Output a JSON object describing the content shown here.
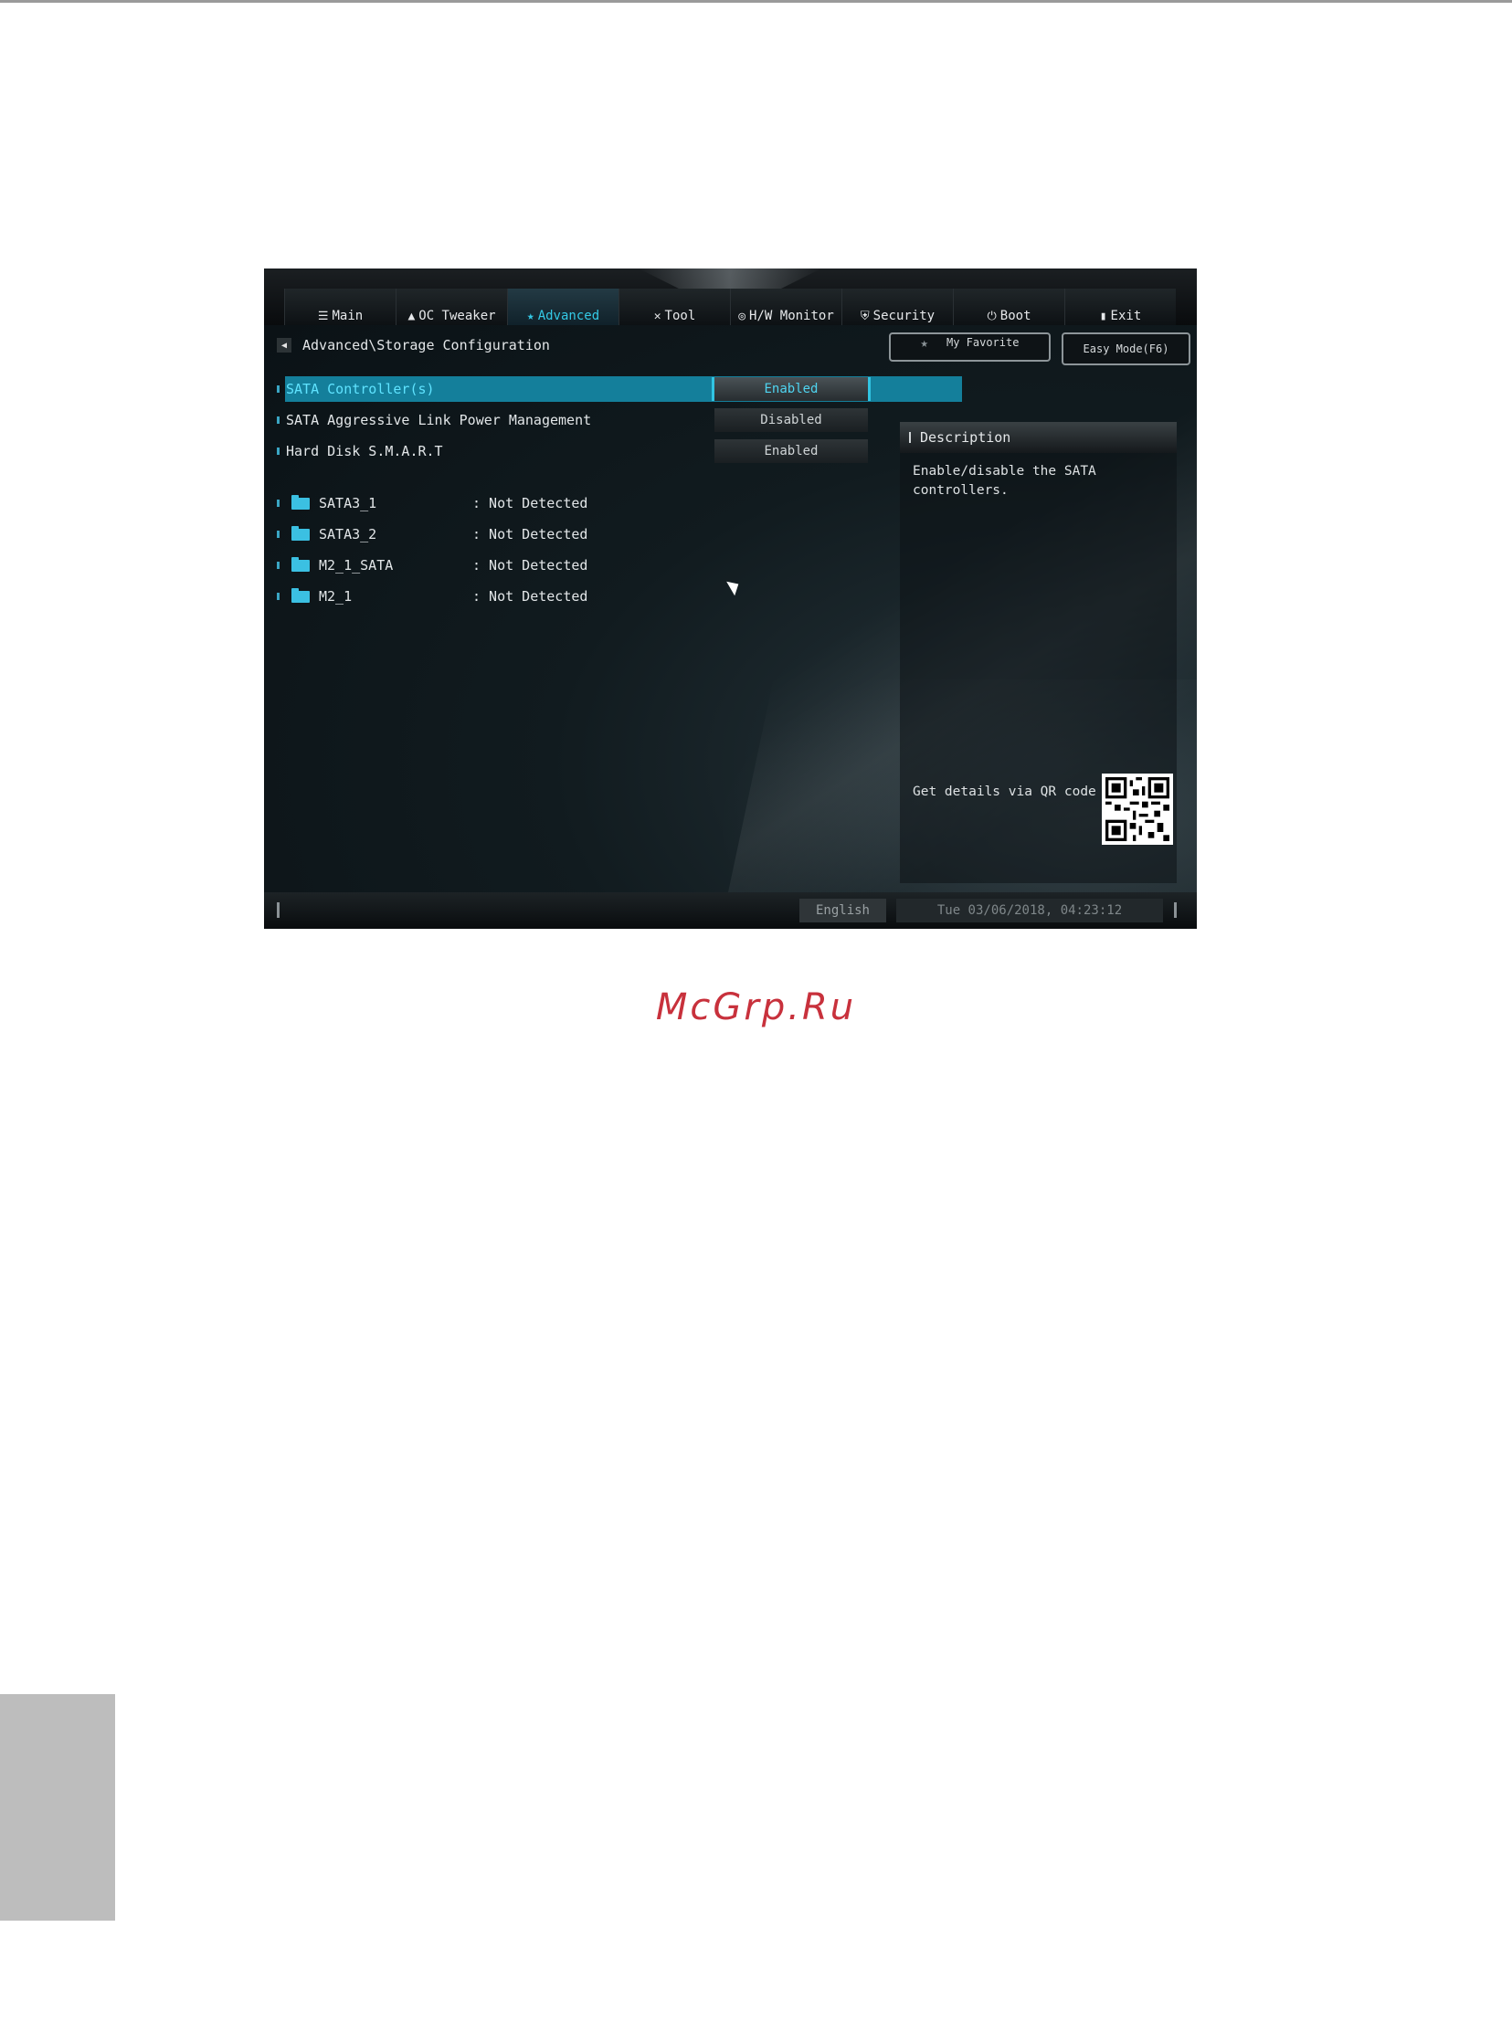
{
  "watermark": "McGrp.Ru",
  "tabs": [
    {
      "label": "Main",
      "icon": "list-icon"
    },
    {
      "label": "OC Tweaker",
      "icon": "rocket-icon"
    },
    {
      "label": "Advanced",
      "icon": "star-arrow-icon"
    },
    {
      "label": "Tool",
      "icon": "tools-icon"
    },
    {
      "label": "H/W Monitor",
      "icon": "monitor-icon"
    },
    {
      "label": "Security",
      "icon": "shield-icon"
    },
    {
      "label": "Boot",
      "icon": "power-icon"
    },
    {
      "label": "Exit",
      "icon": "exit-icon"
    }
  ],
  "active_tab": "Advanced",
  "breadcrumb": "Advanced\\Storage Configuration",
  "buttons": {
    "favorite": "My Favorite",
    "easy_mode": "Easy Mode(F6)"
  },
  "settings": [
    {
      "label": "SATA Controller(s)",
      "value": "Enabled",
      "selected": true
    },
    {
      "label": "SATA Aggressive Link Power Management",
      "value": "Disabled",
      "selected": false
    },
    {
      "label": "Hard Disk S.M.A.R.T",
      "value": "Enabled",
      "selected": false
    }
  ],
  "devices": [
    {
      "name": "SATA3_1",
      "status": ": Not Detected"
    },
    {
      "name": "SATA3_2",
      "status": ": Not Detected"
    },
    {
      "name": "M2_1_SATA",
      "status": ": Not Detected"
    },
    {
      "name": "M2_1",
      "status": ": Not Detected"
    }
  ],
  "description": {
    "title": "Description",
    "text_line1": "Enable/disable the SATA",
    "text_line2": "controllers.",
    "qr_label": "Get details via QR code"
  },
  "footer": {
    "language": "English",
    "datetime": "Tue 03/06/2018, 04:23:12"
  },
  "colors": {
    "accent": "#34c9e6",
    "selection": "#147f9b",
    "watermark": "#c8313c"
  }
}
